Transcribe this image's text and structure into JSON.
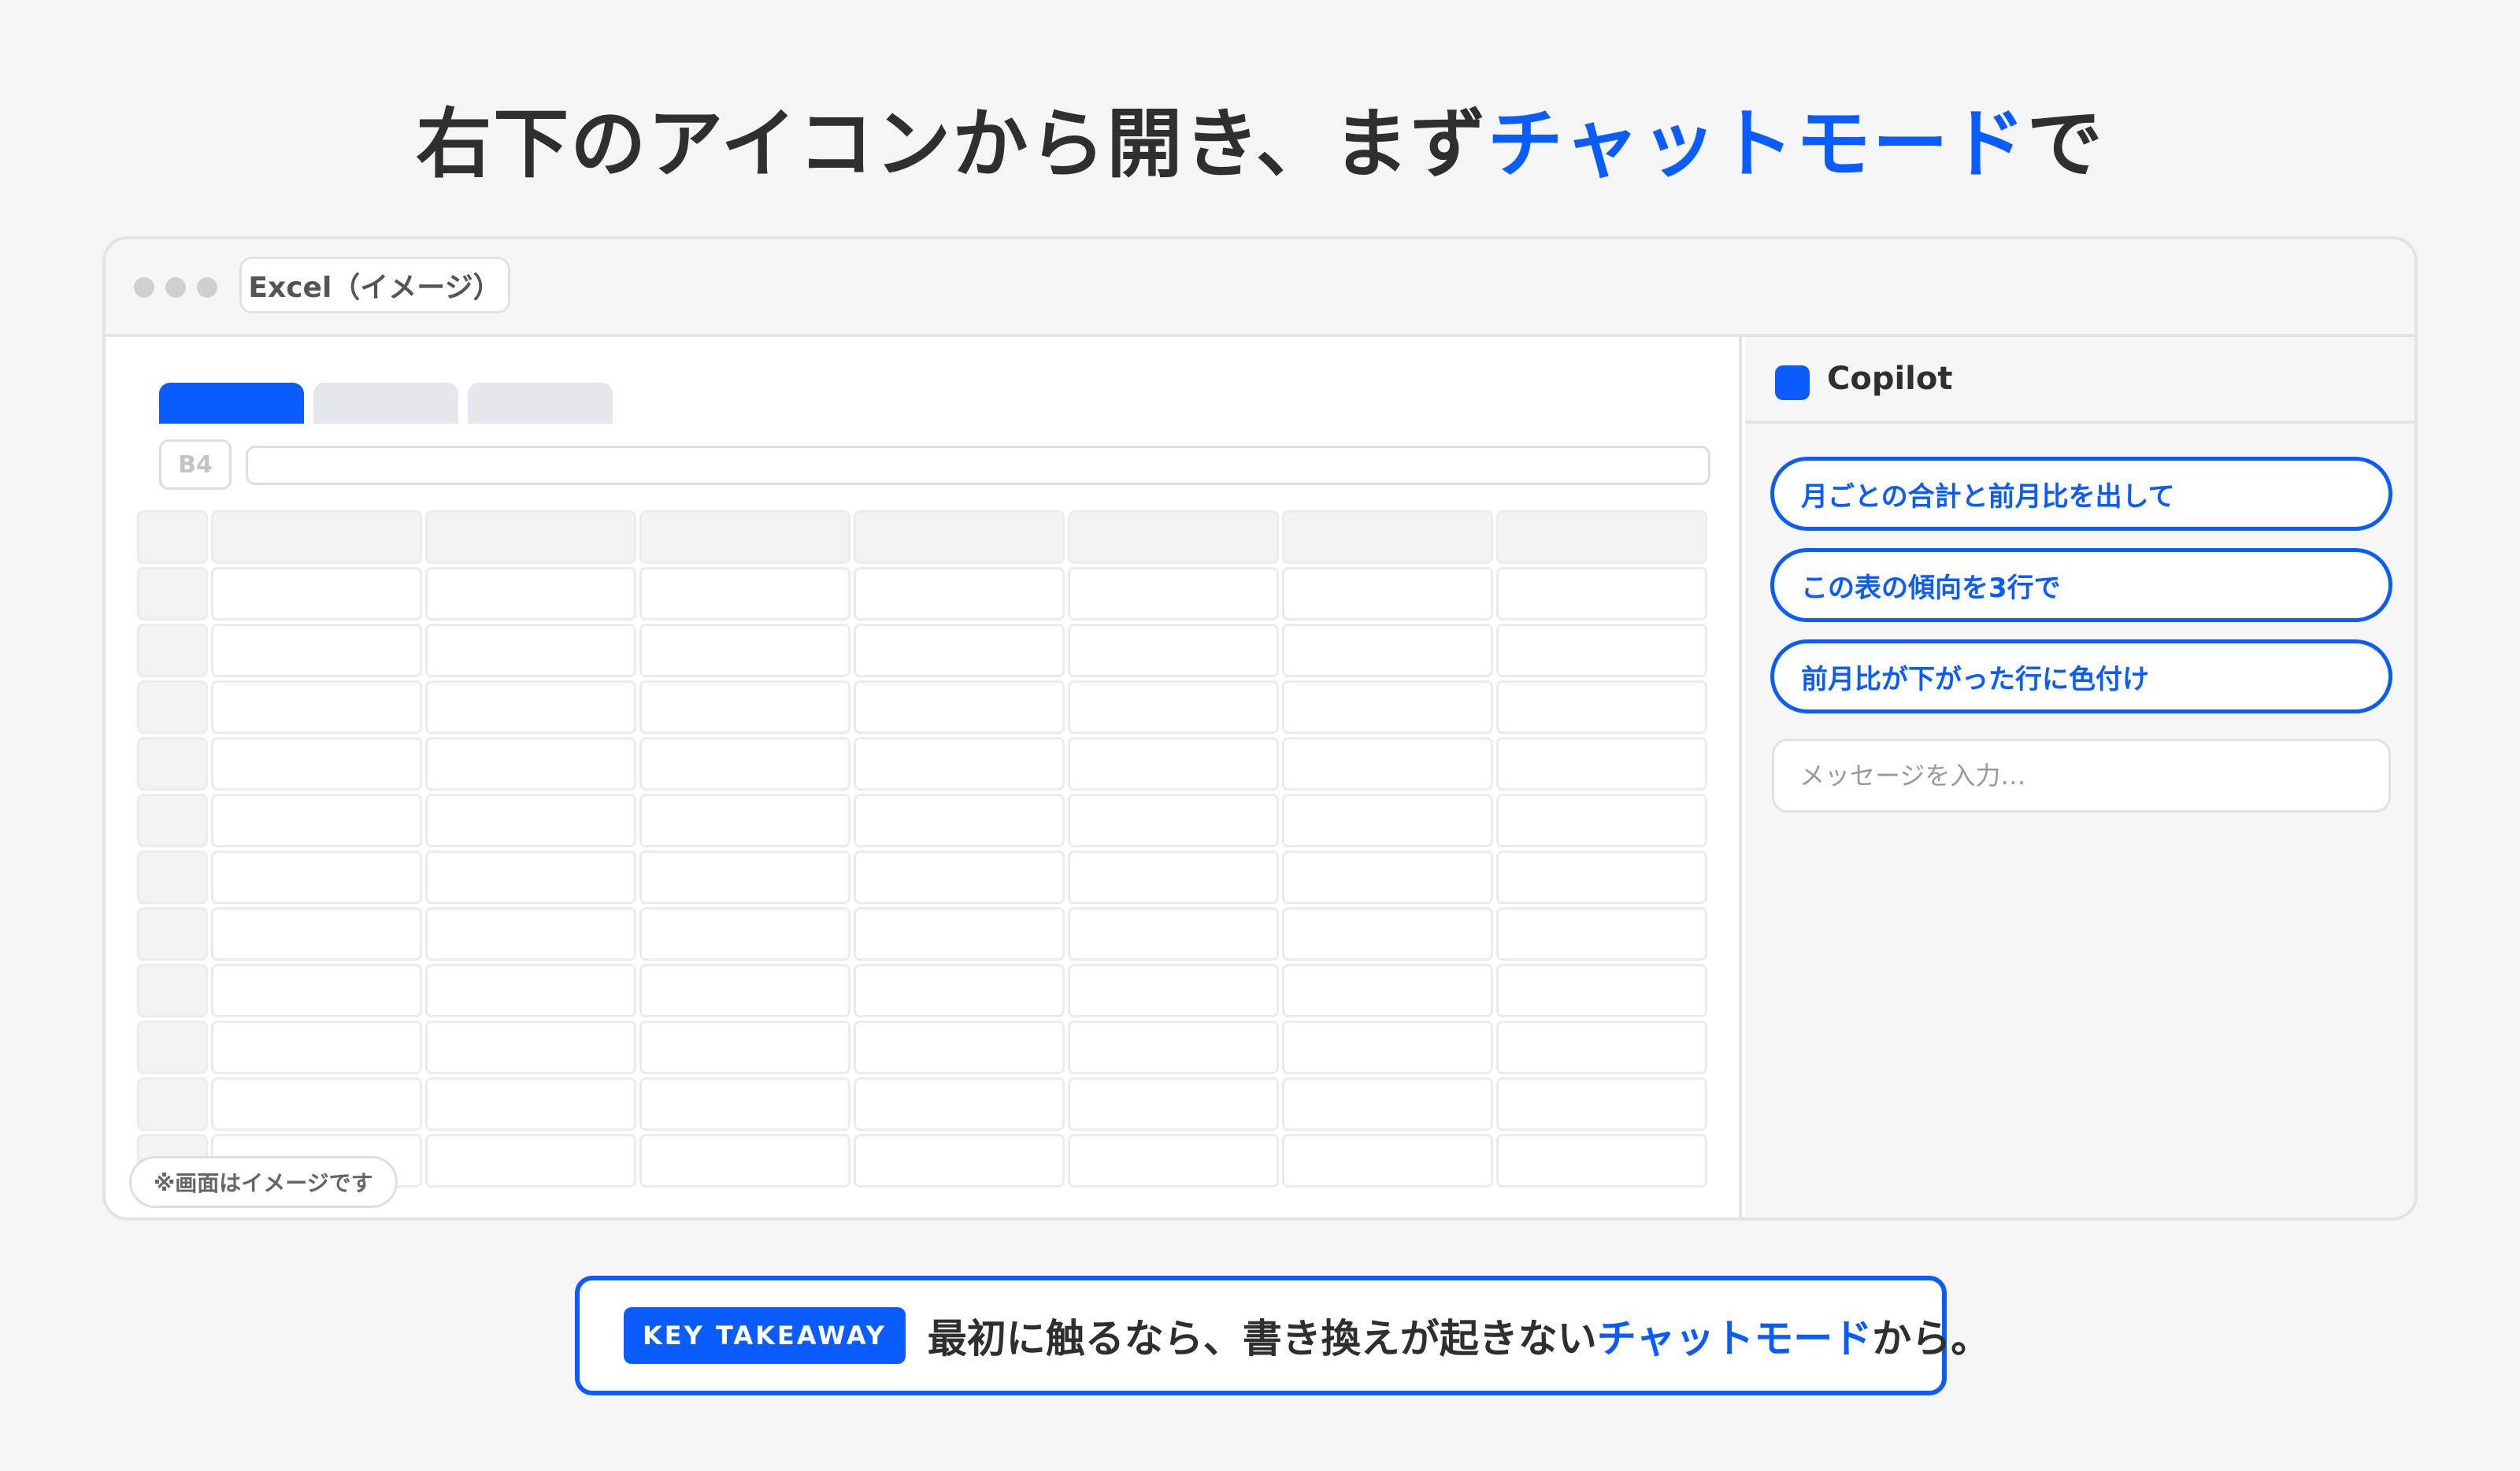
{
  "headline": {
    "prefix": "右下のアイコンから開き、まず",
    "accent": "チャットモード",
    "suffix": "で"
  },
  "window": {
    "tab_title": "Excel（イメージ）"
  },
  "sheet": {
    "cell_reference": "B4",
    "formula_value": "",
    "note": "※画面はイメージです"
  },
  "copilot": {
    "title": "Copilot",
    "suggestions": [
      "月ごとの合計と前月比を出して",
      "この表の傾向を3行で",
      "前月比が下がった行に色付け"
    ],
    "input_placeholder": "メッセージを入力…"
  },
  "takeaway": {
    "badge": "KEY TAKEAWAY",
    "prefix": "最初に触るなら、書き換えが起きない",
    "accent": "チャットモード",
    "suffix": "から。"
  },
  "colors": {
    "accent": "#0b5cff",
    "background": "#f5f5f5",
    "text": "#2f2f2f"
  }
}
